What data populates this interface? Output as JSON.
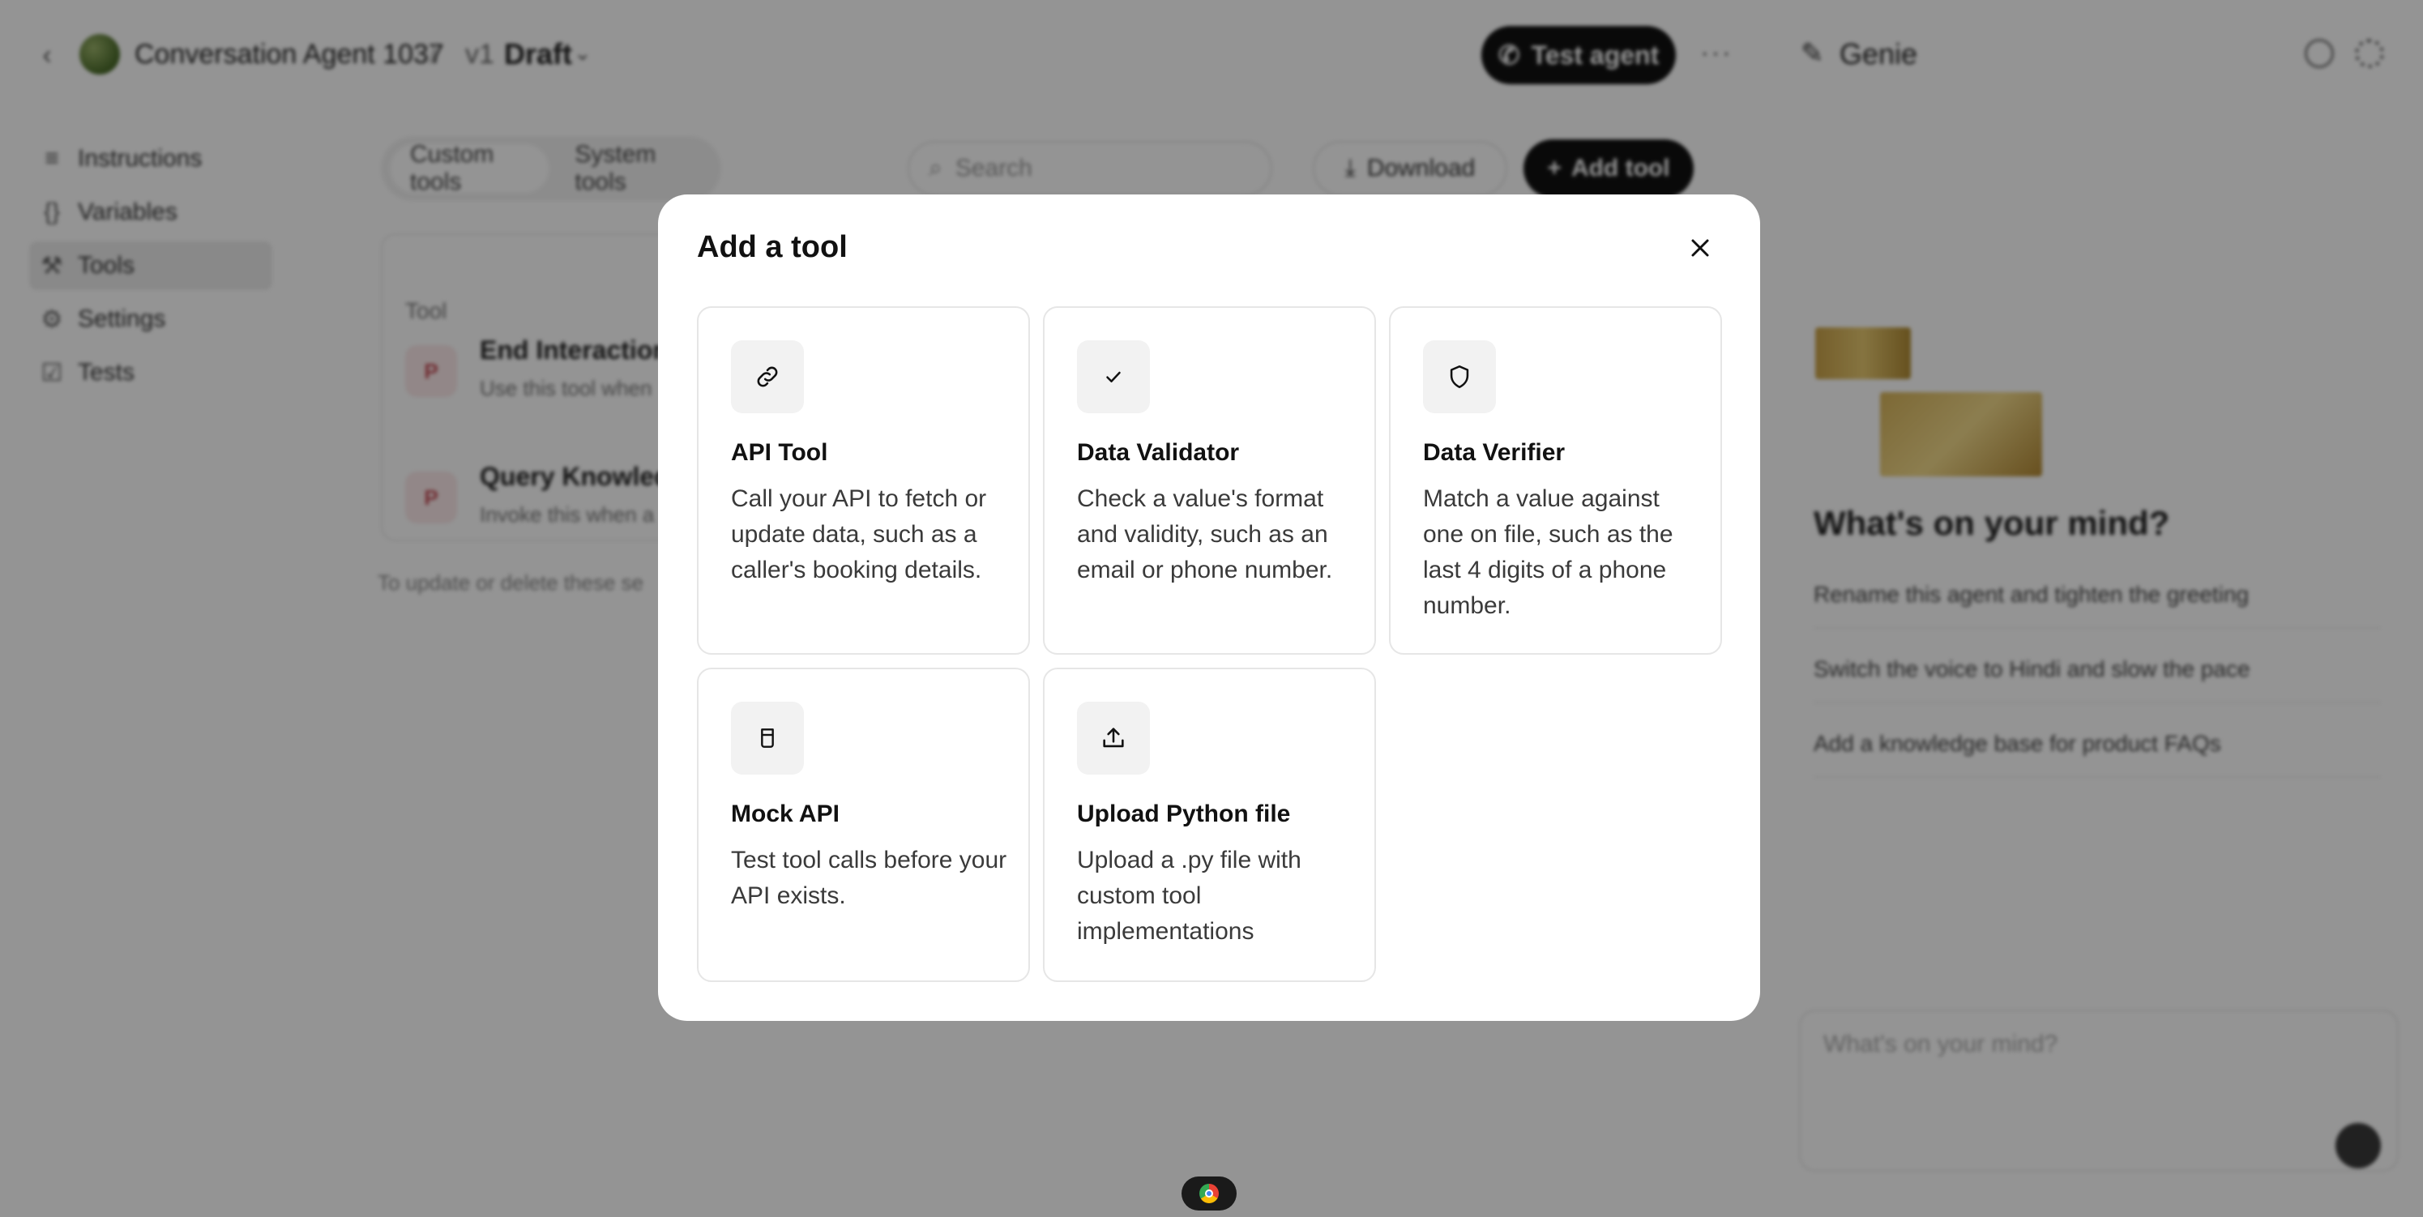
{
  "header": {
    "agent_name": "Conversation Agent 1037",
    "version": "v1",
    "version_state": "Draft",
    "test_button": "Test agent",
    "more_label": "···"
  },
  "sidebar": {
    "items": [
      {
        "label": "Instructions",
        "icon": "≡"
      },
      {
        "label": "Variables",
        "icon": "{}"
      },
      {
        "label": "Tools",
        "icon": "⚒"
      },
      {
        "label": "Settings",
        "icon": "⚙"
      },
      {
        "label": "Tests",
        "icon": "☑"
      }
    ]
  },
  "main": {
    "tabs": [
      "Custom tools",
      "System tools"
    ],
    "search_placeholder": "Search",
    "download_label": "Download",
    "add_tool_label": "Add tool",
    "table_header": "Tool",
    "rows": [
      {
        "icon": "P",
        "name": "End Interaction",
        "desc": "Use this tool when"
      },
      {
        "icon": "P",
        "name": "Query Knowledge",
        "desc": "Invoke this when a"
      }
    ],
    "footnote": "To update or delete these se"
  },
  "genie": {
    "title": "Genie",
    "heading": "What's on your mind?",
    "suggestions": [
      "Rename this agent and tighten the greeting",
      "Switch the voice to Hindi and slow the pace",
      "Add a knowledge base for product FAQs"
    ],
    "input_placeholder": "What's on your mind?"
  },
  "modal": {
    "title": "Add a tool",
    "cards": [
      {
        "icon": "link-icon",
        "title": "API Tool",
        "description": "Call your API to fetch or update data, such as a caller's booking details."
      },
      {
        "icon": "check-icon",
        "title": "Data Validator",
        "description": "Check a value's format and validity, such as an email or phone number."
      },
      {
        "icon": "shield-icon",
        "title": "Data Verifier",
        "description": "Match a value against one on file, such as the last 4 digits of a phone number."
      },
      {
        "icon": "cup-icon",
        "title": "Mock API",
        "description": "Test tool calls before your API exists."
      },
      {
        "icon": "upload-icon",
        "title": "Upload Python file",
        "description": "Upload a .py file with custom tool implementations"
      }
    ]
  },
  "colors": {
    "accent": "#111111",
    "overlay": "rgba(0,0,0,0.42)",
    "card_icon_bg": "#f2f2f2"
  }
}
